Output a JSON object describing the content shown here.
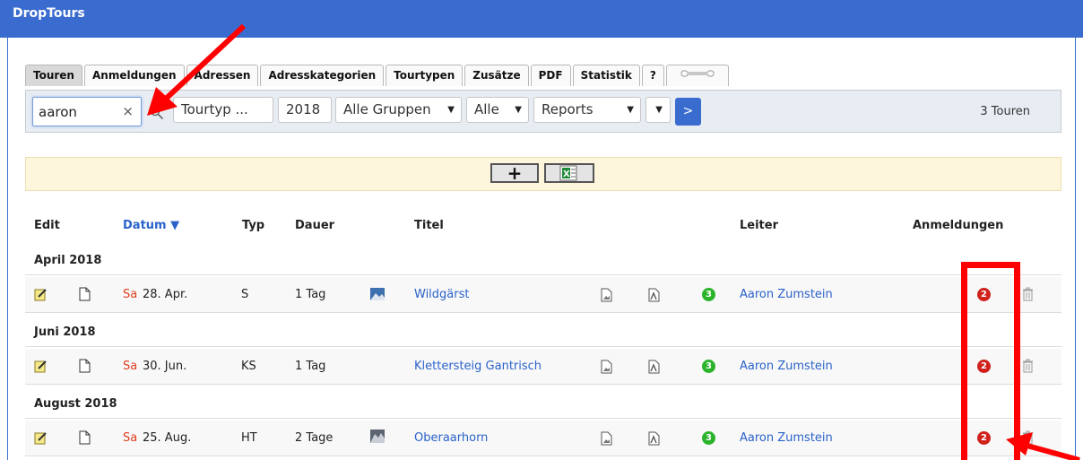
{
  "app": {
    "title": "DropTours"
  },
  "tabs": [
    {
      "label": "Touren"
    },
    {
      "label": "Anmeldungen"
    },
    {
      "label": "Adressen"
    },
    {
      "label": "Adresskategorien"
    },
    {
      "label": "Tourtypen"
    },
    {
      "label": "Zusätze"
    },
    {
      "label": "PDF"
    },
    {
      "label": "Statistik"
    },
    {
      "label": "?"
    }
  ],
  "filters": {
    "search_value": "aaron",
    "clear_glyph": "×",
    "tourtyp": "Tourtyp ...",
    "year": "2018",
    "gruppen": "Alle Gruppen",
    "alle": "Alle",
    "reports": "Reports",
    "go_label": ">",
    "count": "3 Touren"
  },
  "actions": {
    "add_label": "+"
  },
  "columns": {
    "edit": "Edit",
    "datum": "Datum ▼",
    "typ": "Typ",
    "dauer": "Dauer",
    "titel": "Titel",
    "leiter": "Leiter",
    "anmeldungen": "Anmeldungen"
  },
  "groups": [
    {
      "month": "April 2018",
      "tour": {
        "day": "Sa",
        "date": "28. Apr.",
        "typ": "S",
        "dauer": "1 Tag",
        "titel": "Wildgärst",
        "docs": "3",
        "leiter": "Aaron Zumstein",
        "anmeldungen": "2",
        "has_photo": true
      }
    },
    {
      "month": "Juni 2018",
      "tour": {
        "day": "Sa",
        "date": "30. Jun.",
        "typ": "KS",
        "dauer": "1 Tag",
        "titel": "Klettersteig Gantrisch",
        "docs": "3",
        "leiter": "Aaron Zumstein",
        "anmeldungen": "2",
        "has_photo": false
      }
    },
    {
      "month": "August 2018",
      "tour": {
        "day": "Sa",
        "date": "25. Aug.",
        "typ": "HT",
        "dauer": "2 Tage",
        "titel": "Oberaarhorn",
        "docs": "3",
        "leiter": "Aaron Zumstein",
        "anmeldungen": "2",
        "has_photo": true
      }
    }
  ],
  "colors": {
    "brand": "#3a6ccf",
    "link": "#2a62c9",
    "weekday": "#e03c1f",
    "badge_green": "#2bb32b",
    "badge_red": "#d0211c",
    "annotation": "#ff0000"
  },
  "icons": [
    "search-icon",
    "edit-icon",
    "document-icon",
    "image-file-icon",
    "pdf-file-icon",
    "trash-icon",
    "excel-icon",
    "wrench-icon"
  ]
}
